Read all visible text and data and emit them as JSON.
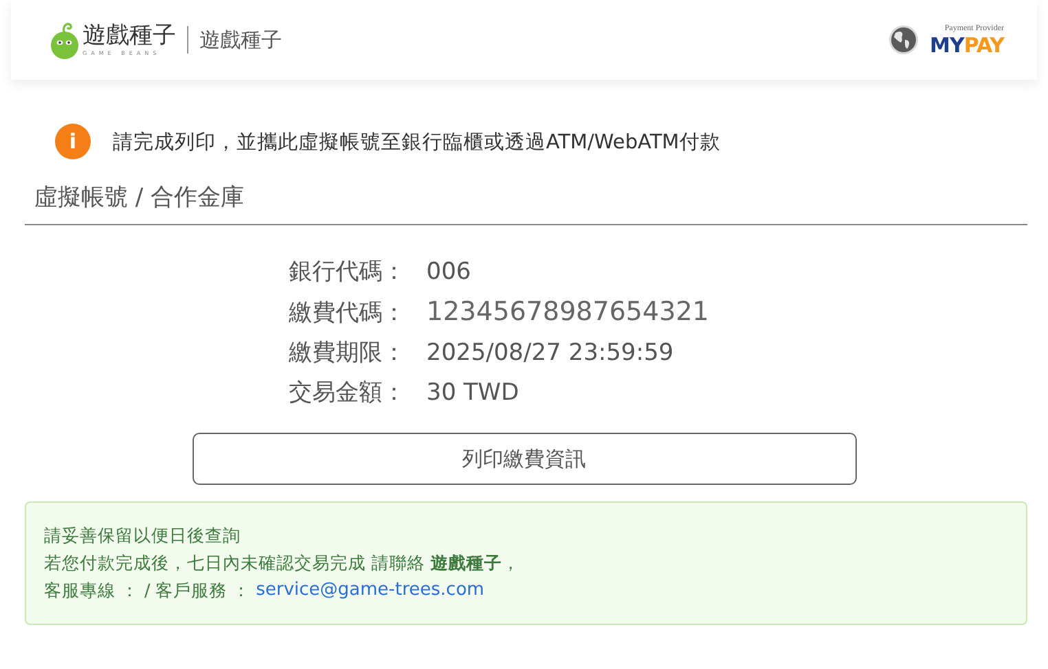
{
  "header": {
    "logo_text": "遊戲種子",
    "logo_tagline": "GAME BEANS",
    "site_title": "遊戲種子",
    "provider_caption": "Payment Provider",
    "provider_brand": "MY",
    "provider_brand_accent": "PAY"
  },
  "notice": {
    "icon": "i",
    "text": "請完成列印，並攜此虛擬帳號至銀行臨櫃或透過ATM/WebATM付款"
  },
  "section_title": "虛擬帳號 / 合作金庫",
  "details": [
    {
      "label": "銀行代碼：",
      "value": "006"
    },
    {
      "label": "繳費代碼：",
      "value": "12345678987654321"
    },
    {
      "label": "繳費期限：",
      "value": "2025/08/27 23:59:59"
    },
    {
      "label": "交易金額：",
      "value": "30 TWD"
    }
  ],
  "print_button": "列印繳費資訊",
  "info_box": {
    "line_1": "請妥善保留以便日後查詢",
    "line_2": "若您付款完成後，七日內未確認交易完成 請聯絡 **遊戲種子**，",
    "line_3": "客服專線 ： / 客戶服務 ：",
    "email": "service@game-trees.com"
  }
}
